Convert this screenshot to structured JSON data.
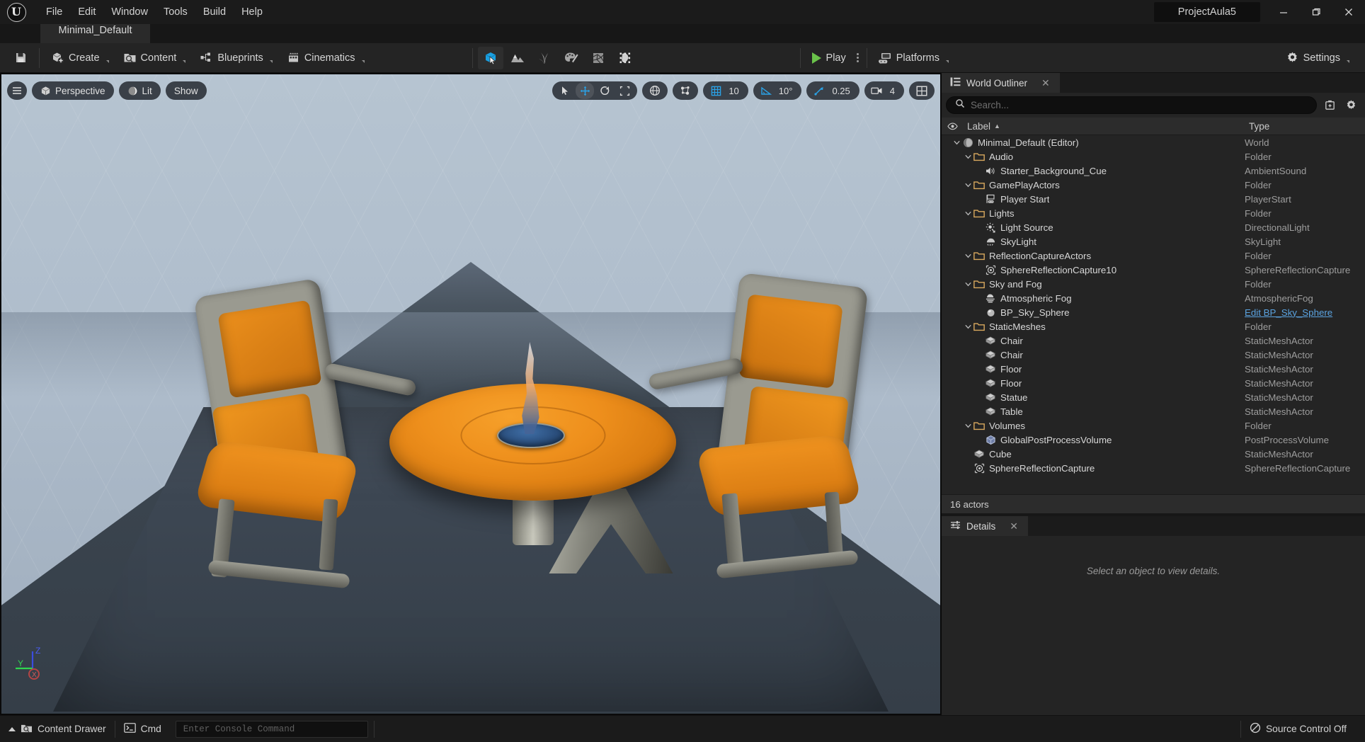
{
  "titlebar": {
    "logo_letter": "U",
    "menus": [
      "File",
      "Edit",
      "Window",
      "Tools",
      "Build",
      "Help"
    ],
    "project_name": "ProjectAula5",
    "window_buttons": {
      "minimize": "—",
      "maximize": "❐",
      "close": "✕"
    }
  },
  "level_tab": {
    "label": "Minimal_Default"
  },
  "toolbar": {
    "save_tooltip": "Save",
    "buttons": [
      {
        "label": "Create",
        "icon": "create-icon"
      },
      {
        "label": "Content",
        "icon": "content-icon"
      },
      {
        "label": "Blueprints",
        "icon": "blueprints-icon"
      },
      {
        "label": "Cinematics",
        "icon": "cinematics-icon"
      }
    ],
    "modes": [
      {
        "name": "select-mode",
        "active": true
      },
      {
        "name": "landscape-mode",
        "active": false
      },
      {
        "name": "foliage-mode",
        "active": false
      },
      {
        "name": "mesh-paint-mode",
        "active": false
      },
      {
        "name": "fracture-mode",
        "active": false
      },
      {
        "name": "brush-edit-mode",
        "active": false
      }
    ],
    "play_label": "Play",
    "platforms_label": "Platforms",
    "settings_label": "Settings"
  },
  "viewport": {
    "menu_icon": "hamburger-icon",
    "perspective_label": "Perspective",
    "lit_label": "Lit",
    "show_label": "Show",
    "transform_tools": [
      "select-tool",
      "move-tool",
      "rotate-tool",
      "scale-tool"
    ],
    "coord_system": "world-coordinates-icon",
    "surface_snap": "surface-snapping-icon",
    "grid_snap_value": "10",
    "angle_snap_value": "10°",
    "scale_snap_value": "0.25",
    "camera_speed_value": "4",
    "layouts_icon": "viewport-layouts-icon",
    "axis_labels": {
      "x": "X",
      "y": "Y",
      "z": "Z"
    }
  },
  "outliner": {
    "tab_label": "World Outliner",
    "tab_close": "✕",
    "search_placeholder": "Search...",
    "search_value": "",
    "columns": {
      "label": "Label",
      "type": "Type",
      "sort_arrow": "▲"
    },
    "rows": [
      {
        "label": "Minimal_Default (Editor)",
        "type": "World",
        "depth": 0,
        "icon": "world-icon",
        "expandable": true
      },
      {
        "label": "Audio",
        "type": "Folder",
        "depth": 1,
        "icon": "folder-icon",
        "expandable": true
      },
      {
        "label": "Starter_Background_Cue",
        "type": "AmbientSound",
        "depth": 2,
        "icon": "sound-icon",
        "expandable": false
      },
      {
        "label": "GamePlayActors",
        "type": "Folder",
        "depth": 1,
        "icon": "folder-icon",
        "expandable": true
      },
      {
        "label": "Player Start",
        "type": "PlayerStart",
        "depth": 2,
        "icon": "player-start-icon",
        "expandable": false
      },
      {
        "label": "Lights",
        "type": "Folder",
        "depth": 1,
        "icon": "folder-icon",
        "expandable": true
      },
      {
        "label": "Light Source",
        "type": "DirectionalLight",
        "depth": 2,
        "icon": "directional-light-icon",
        "expandable": false
      },
      {
        "label": "SkyLight",
        "type": "SkyLight",
        "depth": 2,
        "icon": "sky-light-icon",
        "expandable": false
      },
      {
        "label": "ReflectionCaptureActors",
        "type": "Folder",
        "depth": 1,
        "icon": "folder-icon",
        "expandable": true
      },
      {
        "label": "SphereReflectionCapture10",
        "type": "SphereReflectionCapture",
        "depth": 2,
        "icon": "reflection-capture-icon",
        "expandable": false
      },
      {
        "label": "Sky and Fog",
        "type": "Folder",
        "depth": 1,
        "icon": "folder-icon",
        "expandable": true
      },
      {
        "label": "Atmospheric Fog",
        "type": "AtmosphericFog",
        "depth": 2,
        "icon": "fog-icon",
        "expandable": false
      },
      {
        "label": "BP_Sky_Sphere",
        "type": "Edit BP_Sky_Sphere",
        "type_is_link": true,
        "depth": 2,
        "icon": "sphere-icon",
        "expandable": false
      },
      {
        "label": "StaticMeshes",
        "type": "Folder",
        "depth": 1,
        "icon": "folder-icon",
        "expandable": true
      },
      {
        "label": "Chair",
        "type": "StaticMeshActor",
        "depth": 2,
        "icon": "static-mesh-icon",
        "expandable": false
      },
      {
        "label": "Chair",
        "type": "StaticMeshActor",
        "depth": 2,
        "icon": "static-mesh-icon",
        "expandable": false
      },
      {
        "label": "Floor",
        "type": "StaticMeshActor",
        "depth": 2,
        "icon": "static-mesh-icon",
        "expandable": false
      },
      {
        "label": "Floor",
        "type": "StaticMeshActor",
        "depth": 2,
        "icon": "static-mesh-icon",
        "expandable": false
      },
      {
        "label": "Statue",
        "type": "StaticMeshActor",
        "depth": 2,
        "icon": "static-mesh-icon",
        "expandable": false
      },
      {
        "label": "Table",
        "type": "StaticMeshActor",
        "depth": 2,
        "icon": "static-mesh-icon",
        "expandable": false
      },
      {
        "label": "Volumes",
        "type": "Folder",
        "depth": 1,
        "icon": "folder-icon",
        "expandable": true
      },
      {
        "label": "GlobalPostProcessVolume",
        "type": "PostProcessVolume",
        "depth": 2,
        "icon": "volume-icon",
        "expandable": false
      },
      {
        "label": "Cube",
        "type": "StaticMeshActor",
        "depth": 1,
        "icon": "static-mesh-icon",
        "expandable": false
      },
      {
        "label": "SphereReflectionCapture",
        "type": "SphereReflectionCapture",
        "depth": 1,
        "icon": "reflection-capture-icon",
        "expandable": false
      }
    ],
    "footer": "16 actors"
  },
  "details": {
    "tab_label": "Details",
    "tab_close": "✕",
    "empty_message": "Select an object to view details."
  },
  "statusbar": {
    "content_drawer_label": "Content Drawer",
    "cmd_label": "Cmd",
    "console_placeholder": "Enter Console Command",
    "console_value": "",
    "source_control_label": "Source Control Off"
  },
  "colors": {
    "accent_blue": "#2aa3e8",
    "play_green": "#6ac24a",
    "link_blue": "#5ba3e0",
    "folder_amber": "#d8a258",
    "panel_bg": "#242424",
    "chrome_bg": "#1b1b1b",
    "sky": "#aebccb",
    "table_orange": "#ee8f1c"
  }
}
